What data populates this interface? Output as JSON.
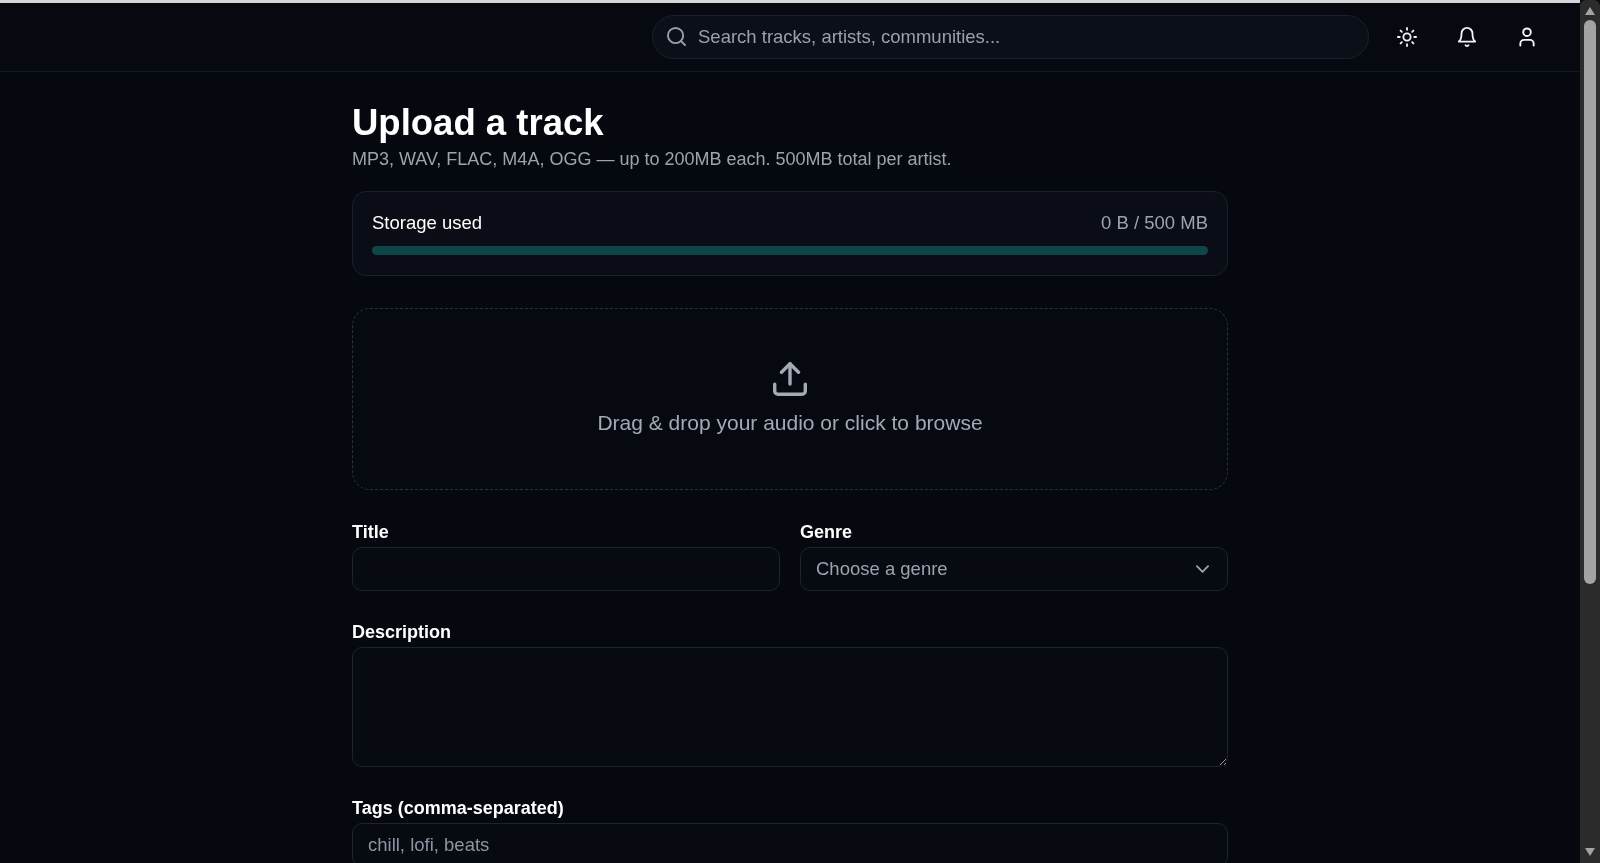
{
  "header": {
    "search": {
      "placeholder": "Search tracks, artists, communities..."
    },
    "actions": [
      {
        "kind": "theme"
      },
      {
        "kind": "notifications"
      },
      {
        "kind": "account"
      }
    ]
  },
  "page": {
    "title": "Upload a track",
    "subtitle": "MP3, WAV, FLAC, M4A, OGG — up to 200MB each. 500MB total per artist."
  },
  "storage": {
    "label": "Storage used",
    "reading": "0 B / 500 MB"
  },
  "dropzone": {
    "text": "Drag & drop your audio or click to browse"
  },
  "form": {
    "rows": [
      [
        {
          "label": "Title",
          "kind": "text"
        },
        {
          "label": "Genre",
          "kind": "select",
          "placeholder": "Choose a genre"
        }
      ],
      [
        {
          "label": "Description",
          "kind": "textarea"
        }
      ],
      [
        {
          "label": "Tags (comma-separated)",
          "kind": "text",
          "placeholder": "chill, lofi, beats"
        }
      ]
    ]
  }
}
